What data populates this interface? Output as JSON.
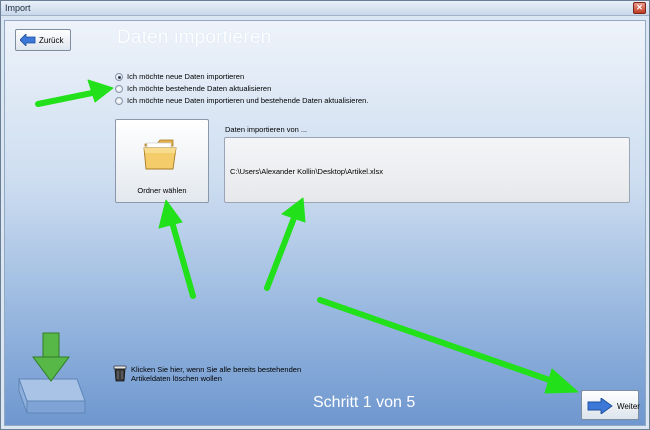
{
  "window": {
    "title": "Import",
    "close_glyph": "✕"
  },
  "toolbar": {
    "back_label": "Zurück",
    "back_icon": "arrow-left-icon"
  },
  "page": {
    "heading": "Daten importieren"
  },
  "options": [
    {
      "label": "Ich möchte neue Daten importieren",
      "checked": true
    },
    {
      "label": "Ich möchte bestehende Daten aktualisieren",
      "checked": false
    },
    {
      "label": "Ich möchte neue Daten importieren und bestehende Daten aktualisieren.",
      "checked": false
    }
  ],
  "folder_button": {
    "label": "Ordner wählen",
    "icon": "folder-icon"
  },
  "import_path": {
    "caption": "Daten importieren von ...",
    "value": "C:\\Users\\Alexander Kollin\\Desktop\\Artikel.xlsx"
  },
  "delete_option": {
    "text_line1": "Klicken Sie hier, wenn Sie alle bereits bestehenden",
    "text_line2": "Artikeldaten löschen wollen",
    "icon": "trash-icon"
  },
  "footer": {
    "step": "Schritt 1 von 5",
    "next_label": "Weiter",
    "next_icon": "arrow-right-icon"
  },
  "colors": {
    "annotation_arrow": "#22e01a",
    "heading_text": "#ffffff"
  }
}
